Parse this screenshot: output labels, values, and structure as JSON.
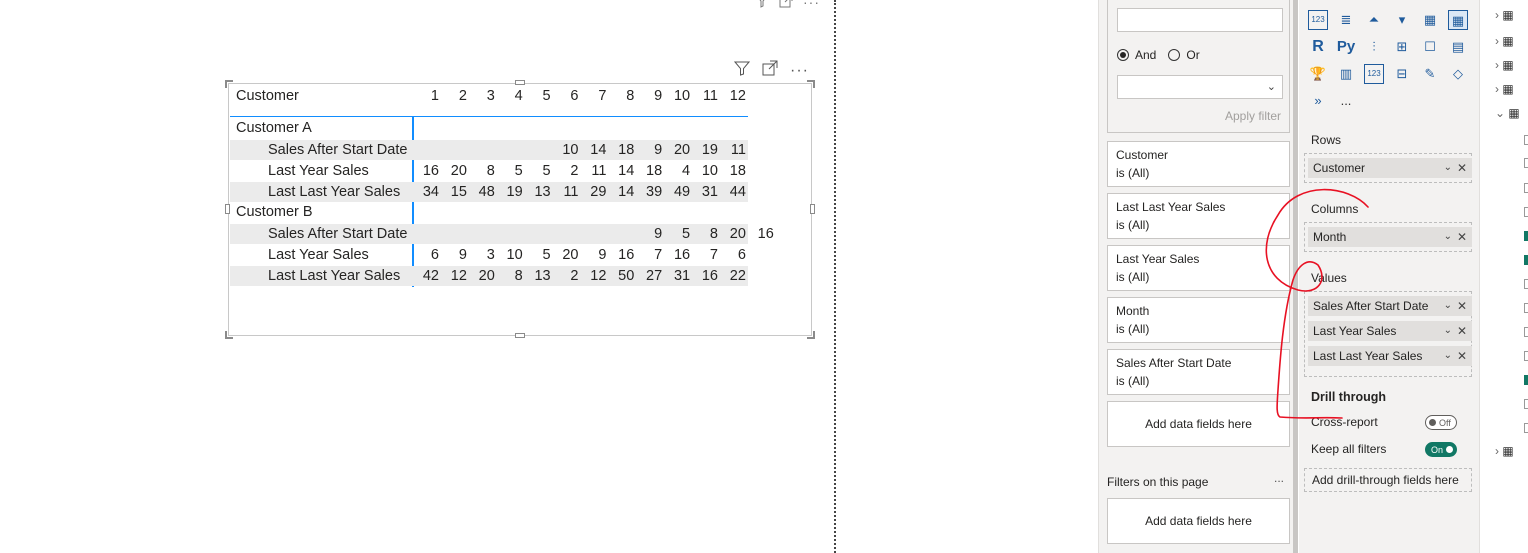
{
  "matrix": {
    "corner_header": "Customer",
    "columns": [
      "1",
      "2",
      "3",
      "4",
      "5",
      "6",
      "7",
      "8",
      "9",
      "10",
      "11",
      "12"
    ],
    "groups": [
      {
        "name": "Customer A",
        "rows": [
          {
            "label": "Sales After Start Date",
            "values": [
              "",
              "",
              "",
              "",
              "",
              "10",
              "14",
              "18",
              "9",
              "20",
              "19",
              "11"
            ]
          },
          {
            "label": "Last Year Sales",
            "values": [
              "16",
              "20",
              "8",
              "5",
              "5",
              "2",
              "11",
              "14",
              "18",
              "4",
              "10",
              "18"
            ]
          },
          {
            "label": "Last Last Year Sales",
            "values": [
              "34",
              "15",
              "48",
              "19",
              "13",
              "11",
              "29",
              "14",
              "39",
              "49",
              "31",
              "44"
            ]
          }
        ]
      },
      {
        "name": "Customer B",
        "rows": [
          {
            "label": "Sales After Start Date",
            "values": [
              "",
              "",
              "",
              "",
              "",
              "",
              "",
              "",
              "9",
              "5",
              "8",
              "20",
              "16"
            ]
          },
          {
            "label": "Last Year Sales",
            "values": [
              "6",
              "9",
              "3",
              "10",
              "5",
              "20",
              "9",
              "16",
              "7",
              "16",
              "7",
              "6"
            ]
          },
          {
            "label": "Last Last Year Sales",
            "values": [
              "42",
              "12",
              "20",
              "8",
              "13",
              "2",
              "12",
              "50",
              "27",
              "31",
              "16",
              "22"
            ]
          }
        ]
      }
    ]
  },
  "filters": {
    "logic_and": "And",
    "logic_or": "Or",
    "apply_label": "Apply filter",
    "cards": [
      {
        "title": "Customer",
        "state": "is (All)"
      },
      {
        "title": "Last Last Year Sales",
        "state": "is (All)"
      },
      {
        "title": "Last Year Sales",
        "state": "is (All)"
      },
      {
        "title": "Month",
        "state": "is (All)"
      },
      {
        "title": "Sales After Start Date",
        "state": "is (All)"
      }
    ],
    "add_fields": "Add data fields here",
    "page_section": "Filters on this page",
    "page_more": "...",
    "page_add_fields": "Add data fields here"
  },
  "visualizations": {
    "rows_label": "Rows",
    "rows_fields": [
      "Customer"
    ],
    "columns_label": "Columns",
    "columns_fields": [
      "Month"
    ],
    "values_label": "Values",
    "values_fields": [
      "Sales After Start Date",
      "Last Year Sales",
      "Last Last Year Sales"
    ],
    "drill_title": "Drill through",
    "cross_report": "Cross-report",
    "cross_toggle": "Off",
    "keep_filters": "Keep all filters",
    "keep_toggle": "On",
    "add_drill": "Add drill-through fields here",
    "more": "...",
    "icon_labels": {
      "r": "R",
      "py": "Py",
      "num": "123",
      "num2": "123"
    }
  },
  "colors": {
    "accent": "#118dff",
    "toggle_on": "#117865",
    "annotation": "#e81123"
  }
}
